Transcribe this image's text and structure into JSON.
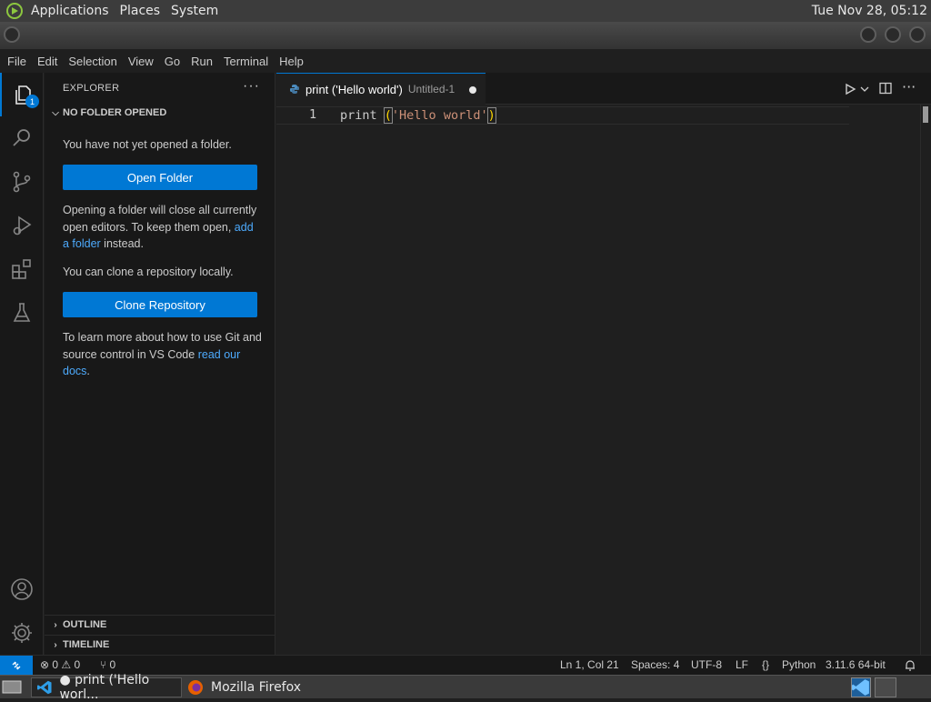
{
  "top_panel": {
    "menus": [
      "Applications",
      "Places",
      "System"
    ],
    "clock": "Tue Nov 28, 05:12"
  },
  "menubar": [
    "File",
    "Edit",
    "Selection",
    "View",
    "Go",
    "Run",
    "Terminal",
    "Help"
  ],
  "activity_bar": {
    "explorer_badge": "1",
    "items": [
      "files-icon",
      "search-icon",
      "source-control-icon",
      "run-debug-icon",
      "extensions-icon",
      "testing-icon",
      "account-icon",
      "settings-gear-icon"
    ]
  },
  "sidebar": {
    "header": "EXPLORER",
    "more": "···",
    "section_title": "NO FOLDER OPENED",
    "msg_not_opened": "You have not yet opened a folder.",
    "open_folder_button": "Open Folder",
    "warning_pre": "Opening a folder will close all currently open editors. To keep them open, ",
    "warning_link": "add a folder",
    "warning_post": " instead.",
    "clone_msg": "You can clone a repository locally.",
    "clone_button": "Clone Repository",
    "git_pre": "To learn more about how to use Git and source control in VS Code ",
    "git_link": "read our docs",
    "git_post": ".",
    "outline": "OUTLINE",
    "timeline": "TIMELINE"
  },
  "editor": {
    "tab_title": "print ('Hello world')",
    "tab_description": "Untitled-1",
    "line_number": "1",
    "code_kw": "print ",
    "code_open": "(",
    "code_str": "'Hello world'",
    "code_close": ")"
  },
  "statusbar": {
    "problems": "⊗ 0 ⚠ 0",
    "ports": "⑂ 0",
    "position": "Ln 1, Col 21",
    "spaces": "Spaces: 4",
    "encoding": "UTF-8",
    "eol": "LF",
    "language": "Python",
    "interpreter": "3.11.6 64-bit"
  },
  "taskbar": {
    "vscode_task": "● print ('Hello worl...",
    "firefox_task": "Mozilla Firefox"
  },
  "colors": {
    "accent": "#0078d4",
    "link": "#4daafc",
    "string": "#ce9178",
    "bracket": "#ffd700"
  }
}
